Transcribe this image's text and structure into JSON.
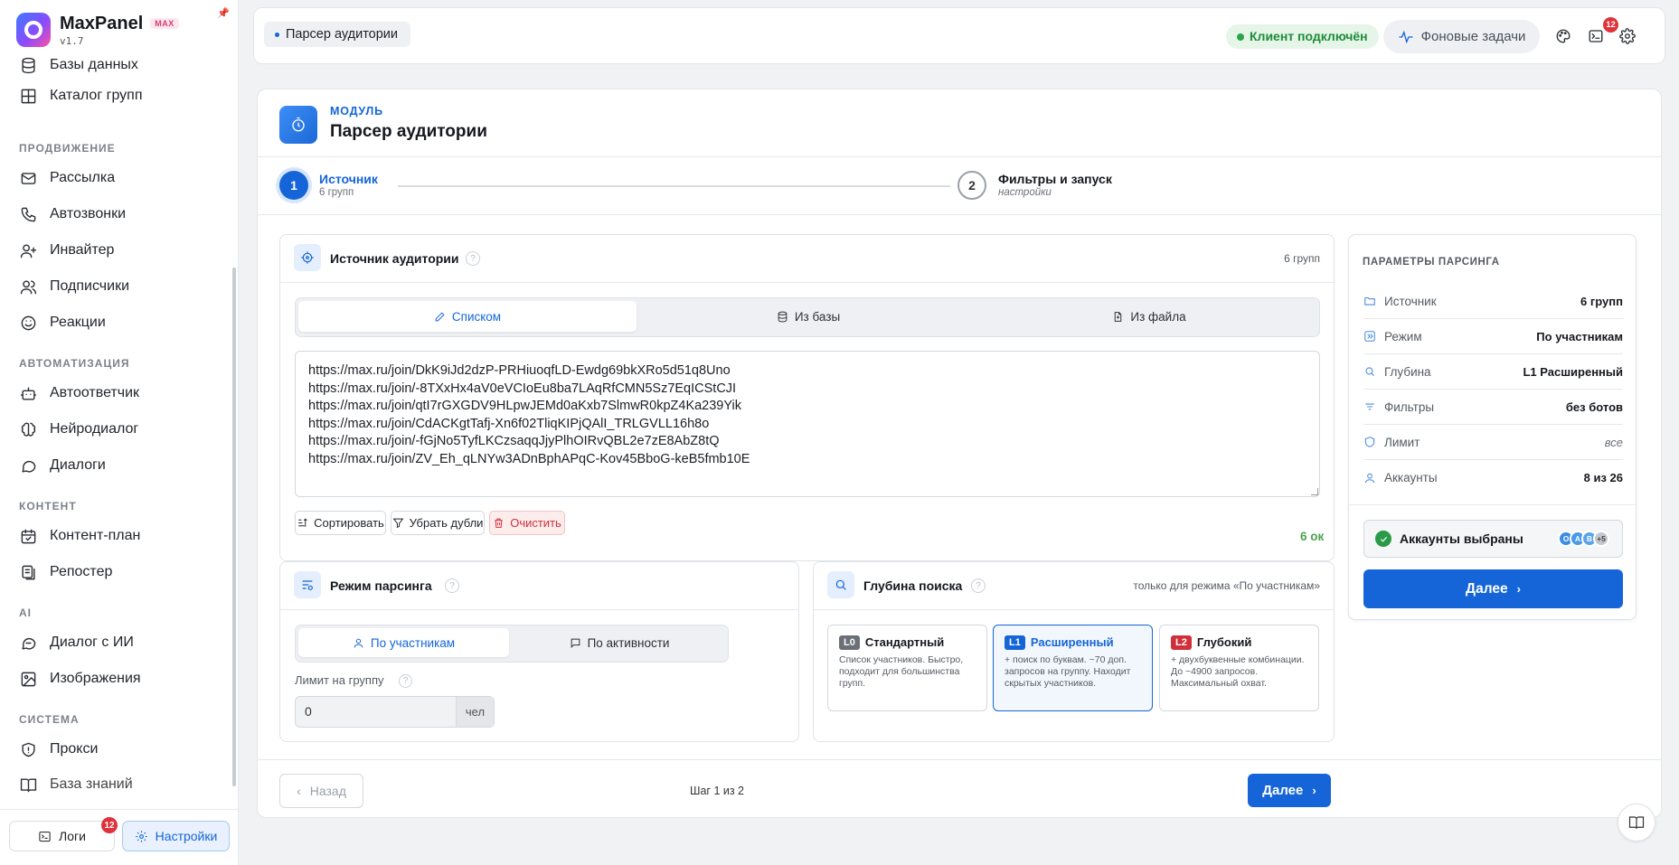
{
  "app": {
    "name": "MaxPanel",
    "badge": "MAX",
    "version": "v1.7"
  },
  "sidebar": {
    "items": [
      {
        "label": "Базы данных",
        "icon": "database-icon"
      },
      {
        "label": "Каталог групп",
        "icon": "grid-icon"
      },
      {
        "section": "ПРОДВИЖЕНИЕ"
      },
      {
        "label": "Рассылка",
        "icon": "mail-icon"
      },
      {
        "label": "Автозвонки",
        "icon": "phone-icon"
      },
      {
        "label": "Инвайтер",
        "icon": "user-plus-icon"
      },
      {
        "label": "Подписчики",
        "icon": "users-icon"
      },
      {
        "label": "Реакции",
        "icon": "smile-icon"
      },
      {
        "section": "АВТОМАТИЗАЦИЯ"
      },
      {
        "label": "Автоответчик",
        "icon": "bot-icon"
      },
      {
        "label": "Нейродиалог",
        "icon": "brain-icon"
      },
      {
        "label": "Диалоги",
        "icon": "chat-icon"
      },
      {
        "section": "КОНТЕНТ"
      },
      {
        "label": "Контент-план",
        "icon": "calendar-icon"
      },
      {
        "label": "Репостер",
        "icon": "copy-icon"
      },
      {
        "section": "AI"
      },
      {
        "label": "Диалог с ИИ",
        "icon": "ai-chat-icon"
      },
      {
        "label": "Изображения",
        "icon": "image-icon"
      },
      {
        "section": "СИСТЕМА"
      },
      {
        "label": "Прокси",
        "icon": "shield-icon"
      },
      {
        "label": "База знаний",
        "icon": "book-icon"
      }
    ],
    "logs_label": "Логи",
    "logs_badge": "12",
    "settings_label": "Настройки"
  },
  "topbar": {
    "breadcrumb": "Парсер аудитории",
    "client_status": "Клиент подключён",
    "tasks_label": "Фоновые задачи",
    "terminal_badge": "12"
  },
  "module": {
    "label": "МОДУЛЬ",
    "title": "Парсер аудитории"
  },
  "steps": [
    {
      "num": "1",
      "title": "Источник",
      "sub": "6 групп"
    },
    {
      "num": "2",
      "title": "Фильтры и запуск",
      "sub": "настройки"
    }
  ],
  "source": {
    "title": "Источник аудитории",
    "count": "6 групп",
    "tabs": [
      "Списком",
      "Из базы",
      "Из файла"
    ],
    "urls": "https://max.ru/join/DkK9iJd2dzP-PRHiuoqfLD-Ewdg69bkXRo5d51q8Uno\nhttps://max.ru/join/-8TXxHx4aV0eVCIoEu8ba7LAqRfCMN5Sz7EqICStCJI\nhttps://max.ru/join/qtI7rGXGDV9HLpwJEMd0aKxb7SlmwR0kpZ4Ka239Yik\nhttps://max.ru/join/CdACKgtTafj-Xn6f02TliqKIPjQAlI_TRLGVLL16h8o\nhttps://max.ru/join/-fGjNo5TyfLKCzsaqqJjyPlhOIRvQBL2e7zE8AbZ8tQ\nhttps://max.ru/join/ZV_Eh_qLNYw3ADnBphAPqC-Kov45BboG-keB5fmb10E",
    "sort_label": "Сортировать",
    "dedupe_label": "Убрать дубли",
    "clear_label": "Очистить",
    "ok_label": "6 ок"
  },
  "mode": {
    "title": "Режим парсинга",
    "tabs": [
      "По участникам",
      "По активности"
    ],
    "limit_label": "Лимит на группу",
    "limit_value": "0",
    "limit_unit": "чел"
  },
  "depth": {
    "title": "Глубина поиска",
    "note": "только для режима «По участникам»",
    "options": [
      {
        "tag": "L0",
        "name": "Стандартный",
        "desc": "Список участников. Быстро, подходит для большинства групп.",
        "color": "#6b6f76"
      },
      {
        "tag": "L1",
        "name": "Расширенный",
        "desc": "+ поиск по буквам. ~70 доп. запросов на группу. Находит скрытых участников.",
        "color": "#1565d8"
      },
      {
        "tag": "L2",
        "name": "Глубокий",
        "desc": "+ двухбуквенные комбинации. До ~4900 запросов. Максимальный охват.",
        "color": "#d0303a"
      }
    ]
  },
  "params": {
    "title": "ПАРАМЕТРЫ ПАРСИНГА",
    "rows": [
      {
        "key": "Источник",
        "value": "6 групп"
      },
      {
        "key": "Режим",
        "value": "По участникам"
      },
      {
        "key": "Глубина",
        "value": "L1 Расширенный"
      },
      {
        "key": "Фильтры",
        "value": "без ботов"
      },
      {
        "key": "Лимит",
        "value": "все"
      },
      {
        "key": "Аккаунты",
        "value": "8 из 26"
      }
    ],
    "accounts_label": "Аккаунты выбраны",
    "avatars": [
      "О",
      "А",
      "В",
      "+5"
    ],
    "next_label": "Далее"
  },
  "footer": {
    "back_label": "Назад",
    "step_text": "Шаг 1 из 2",
    "next_label": "Далее"
  }
}
